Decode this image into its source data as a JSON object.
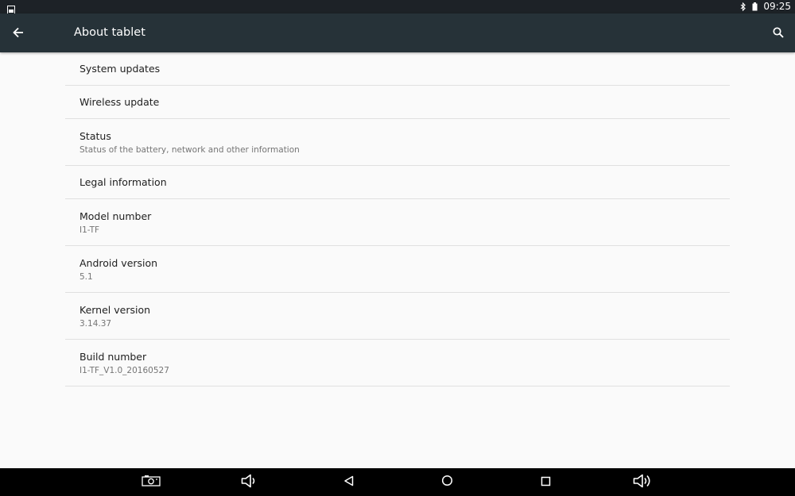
{
  "status_bar": {
    "time": "09:25",
    "icons": [
      "gallery-notification-icon",
      "bluetooth-icon",
      "battery-icon"
    ]
  },
  "app_bar": {
    "title": "About tablet",
    "icons": [
      "back-arrow-icon",
      "search-icon"
    ]
  },
  "preferences": [
    {
      "title": "System updates"
    },
    {
      "title": "Wireless update"
    },
    {
      "title": "Status",
      "summary": "Status of the battery, network and other information"
    },
    {
      "title": "Legal information"
    },
    {
      "title": "Model number",
      "summary": "I1-TF"
    },
    {
      "title": "Android version",
      "summary": "5.1"
    },
    {
      "title": "Kernel version",
      "summary": "3.14.37"
    },
    {
      "title": "Build number",
      "summary": "I1-TF_V1.0_20160527"
    }
  ],
  "nav_bar": {
    "icons": [
      "screenshot-icon",
      "volume-down-icon",
      "back-icon",
      "home-icon",
      "recents-icon",
      "volume-up-icon"
    ]
  },
  "colors": {
    "status_bar_bg": "#1d2227",
    "app_bar_bg": "#263238",
    "background": "#fafafa",
    "nav_bar_bg": "#000000",
    "divider": "#e0e0e0"
  }
}
